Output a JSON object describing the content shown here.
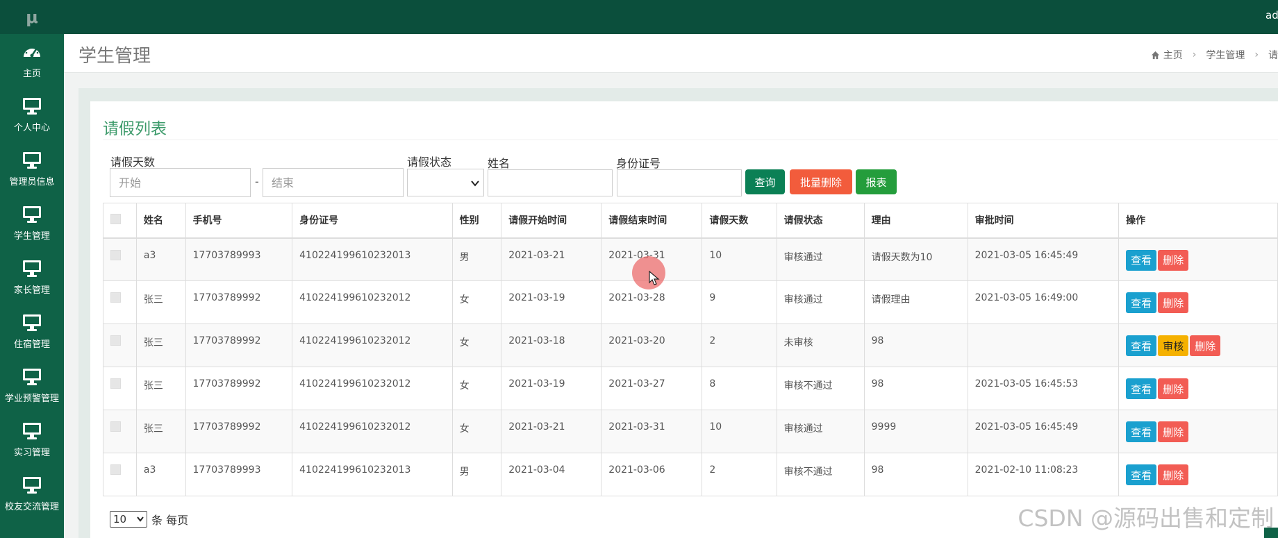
{
  "brand": "μ",
  "user": "admin",
  "sidebar": {
    "items": [
      {
        "label": "主页",
        "icon": "dashboard-icon"
      },
      {
        "label": "个人中心",
        "icon": "monitor-icon"
      },
      {
        "label": "管理员信息",
        "icon": "monitor-icon"
      },
      {
        "label": "学生管理",
        "icon": "monitor-icon"
      },
      {
        "label": "家长管理",
        "icon": "monitor-icon"
      },
      {
        "label": "住宿管理",
        "icon": "monitor-icon"
      },
      {
        "label": "学业预警管理",
        "icon": "monitor-icon"
      },
      {
        "label": "实习管理",
        "icon": "monitor-icon"
      },
      {
        "label": "校友交流管理",
        "icon": "monitor-icon"
      }
    ]
  },
  "header": {
    "title": "学生管理",
    "breadcrumb": [
      "主页",
      "学生管理",
      "请"
    ]
  },
  "panel": {
    "title": "请假列表"
  },
  "filters": {
    "days_label": "请假天数",
    "days_start_placeholder": "开始",
    "days_end_placeholder": "结束",
    "dash": "-",
    "status_label": "请假状态",
    "name_label": "姓名",
    "id_label": "身份证号",
    "query_button": "查询",
    "batch_delete_button": "批量删除",
    "report_button": "报表"
  },
  "table": {
    "columns": [
      "姓名",
      "手机号",
      "身份证号",
      "性别",
      "请假开始时间",
      "请假结束时间",
      "请假天数",
      "请假状态",
      "理由",
      "审批时间",
      "操作"
    ],
    "rows": [
      {
        "name": "a3",
        "phone": "17703789993",
        "idno": "410224199610232013",
        "gender": "男",
        "start": "2021-03-21",
        "end": "2021-03-31",
        "days": "10",
        "status": "审核通过",
        "reason": "请假天数为10",
        "approved": "2021-03-05 16:45:49"
      },
      {
        "name": "张三",
        "phone": "17703789992",
        "idno": "410224199610232012",
        "gender": "女",
        "start": "2021-03-19",
        "end": "2021-03-28",
        "days": "9",
        "status": "审核通过",
        "reason": "请假理由",
        "approved": "2021-03-05 16:49:00"
      },
      {
        "name": "张三",
        "phone": "17703789992",
        "idno": "410224199610232012",
        "gender": "女",
        "start": "2021-03-18",
        "end": "2021-03-20",
        "days": "2",
        "status": "未审核",
        "reason": "98",
        "approved": ""
      },
      {
        "name": "张三",
        "phone": "17703789992",
        "idno": "410224199610232012",
        "gender": "女",
        "start": "2021-03-19",
        "end": "2021-03-27",
        "days": "8",
        "status": "审核不通过",
        "reason": "98",
        "approved": "2021-03-05 16:45:53"
      },
      {
        "name": "张三",
        "phone": "17703789992",
        "idno": "410224199610232012",
        "gender": "女",
        "start": "2021-03-21",
        "end": "2021-03-31",
        "days": "10",
        "status": "审核通过",
        "reason": "9999",
        "approved": "2021-03-05 16:45:49"
      },
      {
        "name": "a3",
        "phone": "17703789993",
        "idno": "410224199610232013",
        "gender": "男",
        "start": "2021-03-04",
        "end": "2021-03-06",
        "days": "2",
        "status": "审核不通过",
        "reason": "98",
        "approved": "2021-02-10 11:08:23"
      }
    ],
    "actions": {
      "view": "查看",
      "audit": "审核",
      "delete": "删除"
    }
  },
  "pagination": {
    "page_size": "10",
    "per_page_label": "条 每页"
  },
  "watermark": "CSDN @源码出售和定制",
  "colors": {
    "topbar": "#0b4f3c",
    "sidebar": "#0f6247",
    "accent_title": "#3c9a6a",
    "view_button": "#1aa0cf",
    "delete_button": "#f25c54",
    "audit_button": "#f5b100"
  }
}
